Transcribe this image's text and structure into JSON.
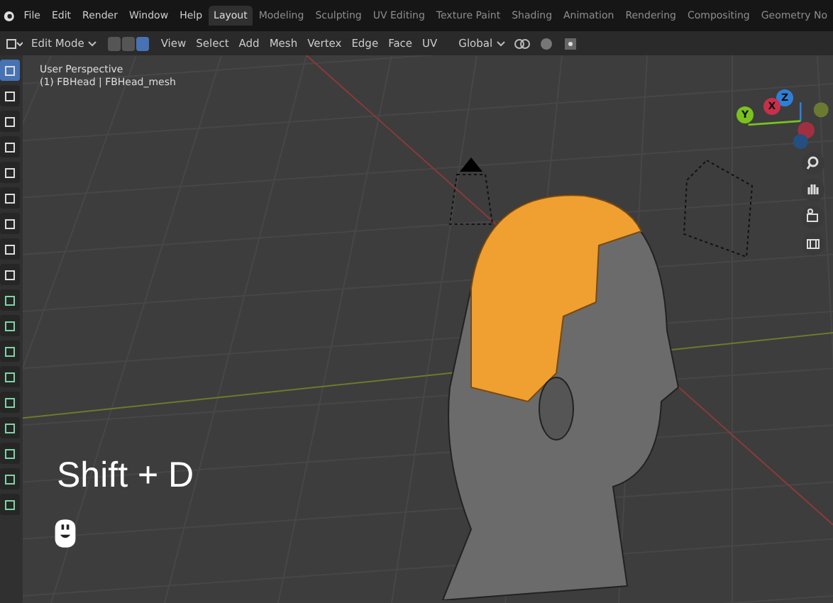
{
  "menu": [
    "File",
    "Edit",
    "Render",
    "Window",
    "Help"
  ],
  "workspaces": [
    {
      "label": "Layout",
      "selected": true
    },
    {
      "label": "Modeling",
      "selected": false
    },
    {
      "label": "Sculpting",
      "selected": false
    },
    {
      "label": "UV Editing",
      "selected": false
    },
    {
      "label": "Texture Paint",
      "selected": false
    },
    {
      "label": "Shading",
      "selected": false
    },
    {
      "label": "Animation",
      "selected": false
    },
    {
      "label": "Rendering",
      "selected": false
    },
    {
      "label": "Compositing",
      "selected": false
    },
    {
      "label": "Geometry No",
      "selected": false
    }
  ],
  "header": {
    "mode": "Edit Mode",
    "select_modes": [
      {
        "selected": false
      },
      {
        "selected": false
      },
      {
        "selected": true
      }
    ],
    "menus": [
      "View",
      "Select",
      "Add",
      "Mesh",
      "Vertex",
      "Edge",
      "Face",
      "UV"
    ],
    "orientation": "Global"
  },
  "tools": [
    {
      "selected": true
    },
    {
      "selected": false
    },
    {
      "selected": false
    },
    {
      "selected": false
    },
    {
      "selected": false
    },
    {
      "selected": false
    },
    {
      "selected": false
    },
    {
      "selected": false
    },
    {
      "selected": false
    },
    {
      "selected": false
    },
    {
      "selected": false
    },
    {
      "selected": false
    },
    {
      "selected": false
    },
    {
      "selected": false
    },
    {
      "selected": false
    },
    {
      "selected": false
    },
    {
      "selected": false
    },
    {
      "selected": false
    }
  ],
  "viewport": {
    "view_name": "User Perspective",
    "object": "(1) FBHead | FBHead_mesh",
    "shortcut": "Shift + D"
  },
  "gizmo": [
    {
      "label": "Z",
      "color": "#2f7fd8"
    },
    {
      "label": "X",
      "color": "#c8304a"
    },
    {
      "label": "Y",
      "color": "#7ac21e"
    }
  ]
}
